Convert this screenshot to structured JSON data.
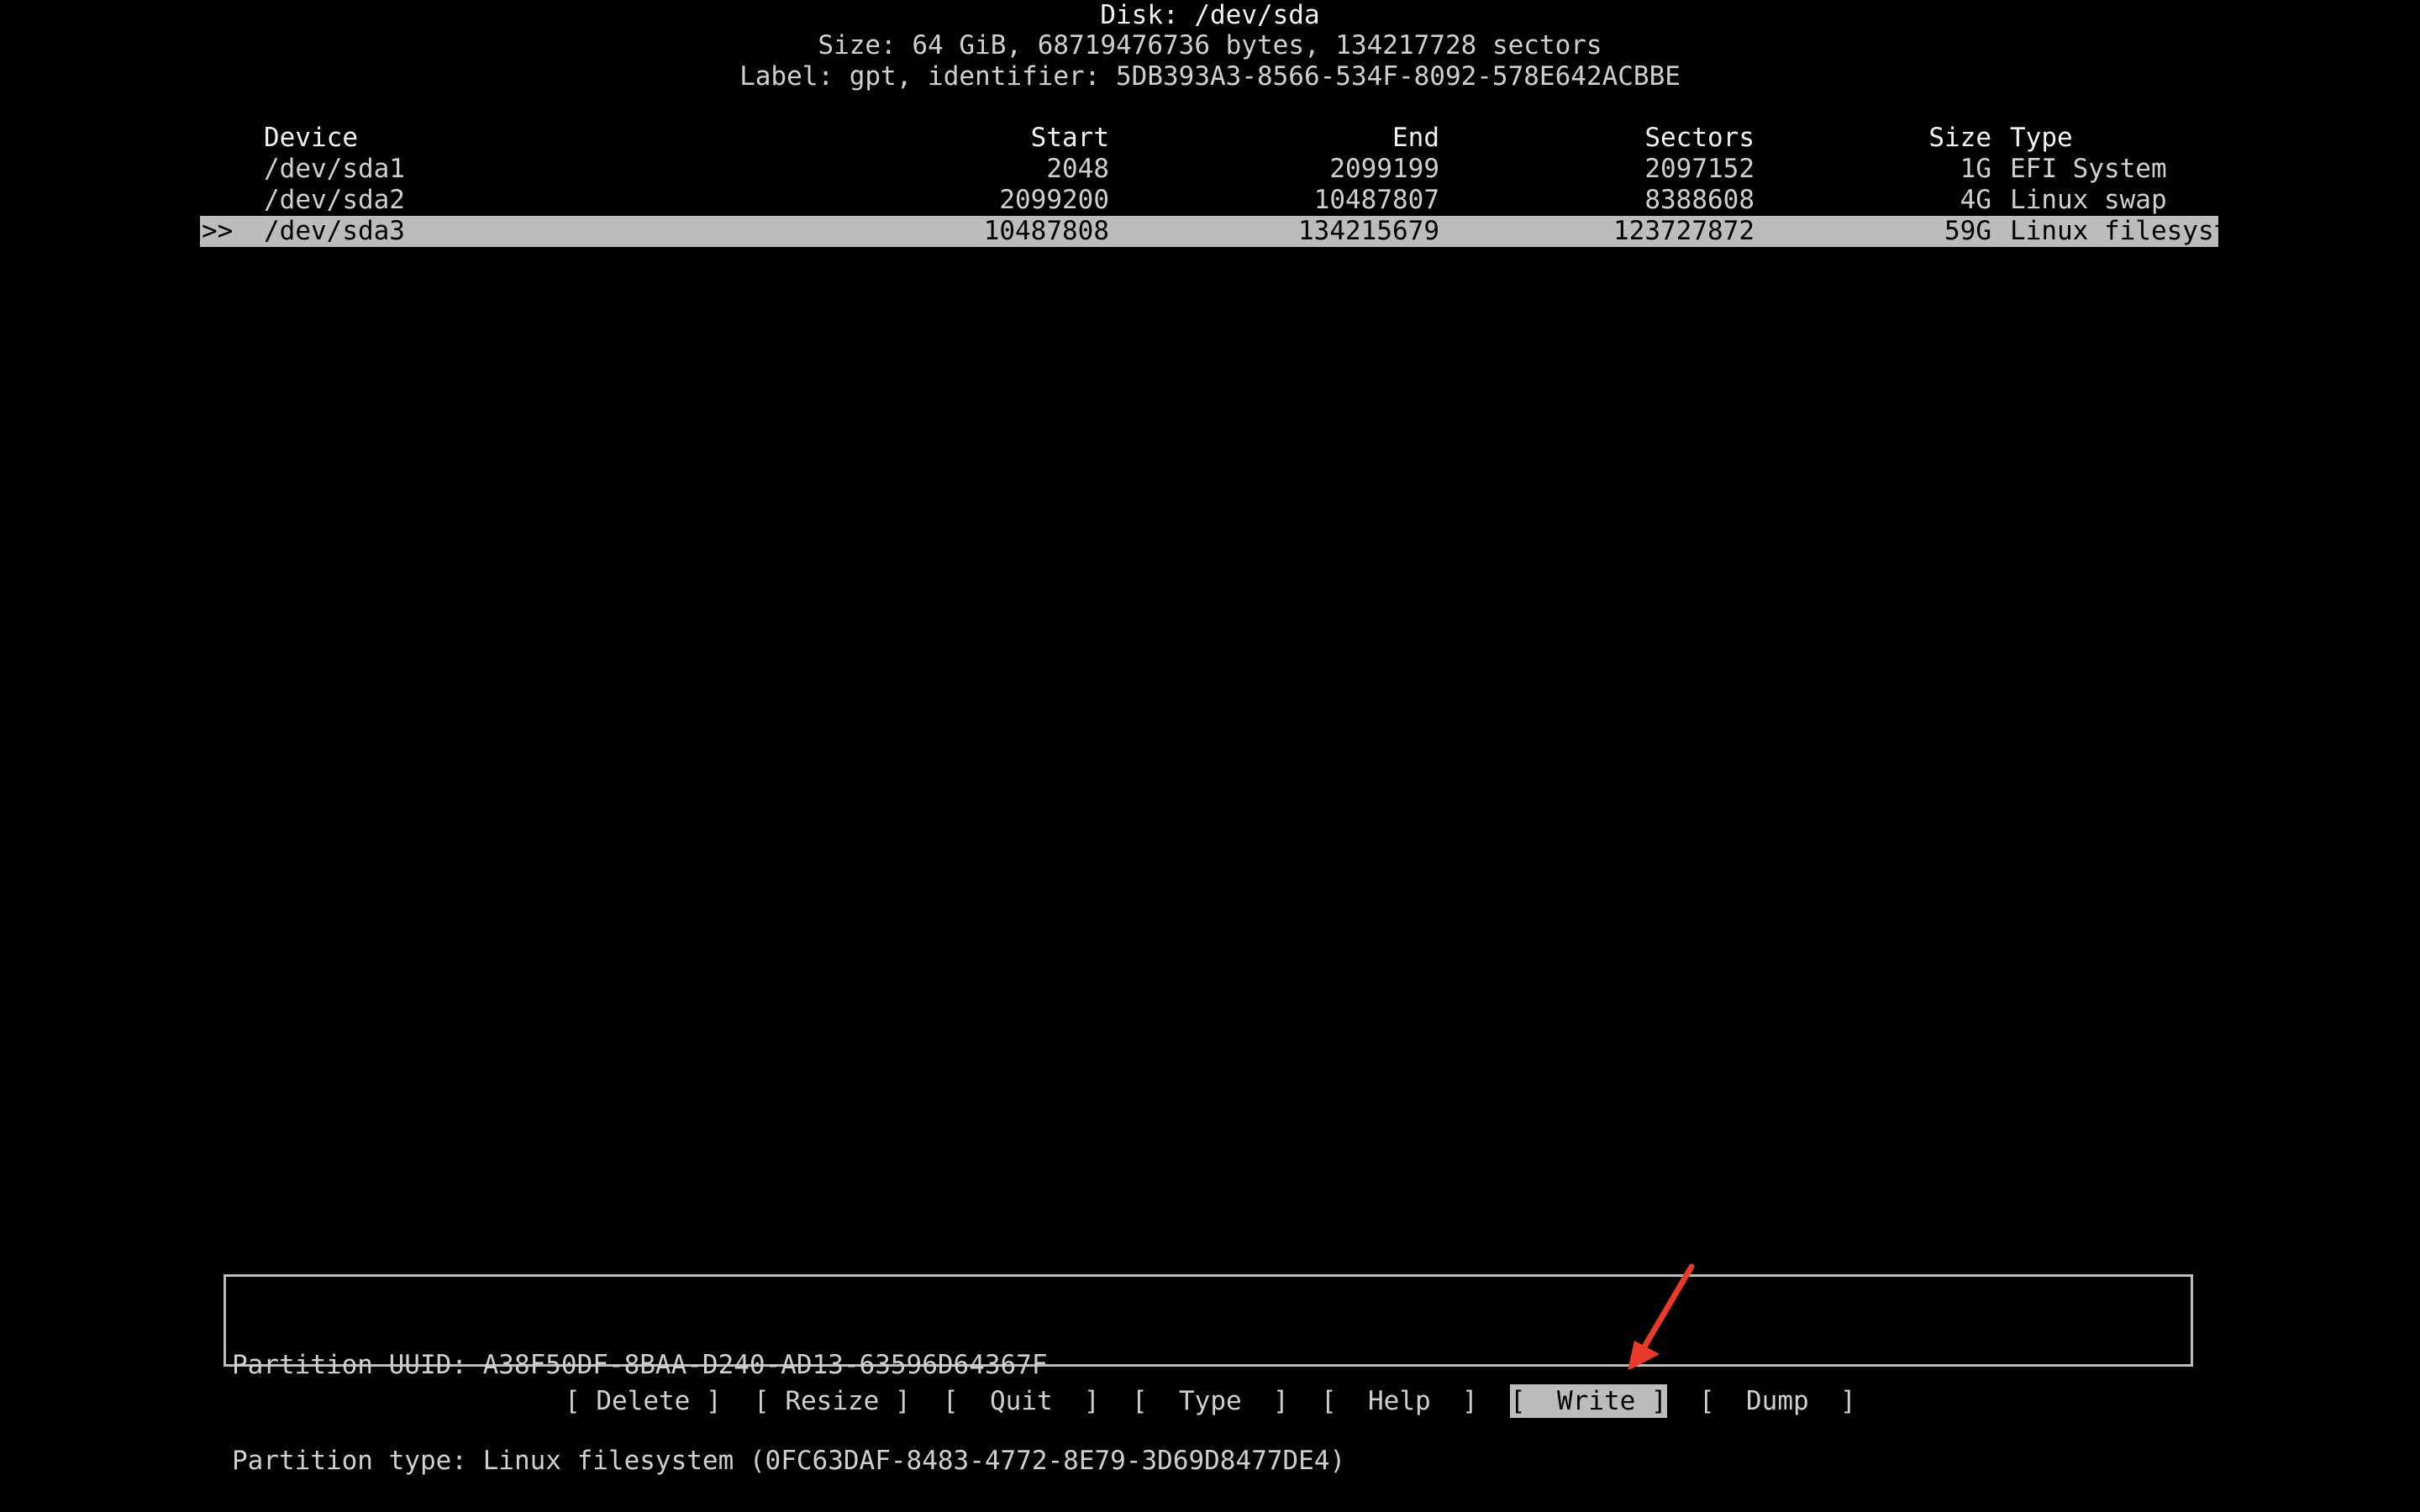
{
  "disk": {
    "title": "Disk: /dev/sda",
    "size": "Size: 64 GiB, 68719476736 bytes, 134217728 sectors",
    "label": "Label: gpt, identifier: 5DB393A3-8566-534F-8092-578E642ACBBE"
  },
  "table": {
    "headers": {
      "device": "Device",
      "start": "Start",
      "end": "End",
      "sectors": "Sectors",
      "size": "Size",
      "type": "Type"
    },
    "rows": [
      {
        "marker": "",
        "device": "/dev/sda1",
        "start": "2048",
        "end": "2099199",
        "sectors": "2097152",
        "size": "1G",
        "type": "EFI System"
      },
      {
        "marker": "",
        "device": "/dev/sda2",
        "start": "2099200",
        "end": "10487807",
        "sectors": "8388608",
        "size": "4G",
        "type": "Linux swap"
      },
      {
        "marker": ">>",
        "device": "/dev/sda3",
        "start": "10487808",
        "end": "134215679",
        "sectors": "123727872",
        "size": "59G",
        "type": "Linux filesystem"
      }
    ]
  },
  "info": {
    "uuid": "Partition UUID: A38F50DF-8BAA-D240-AD13-63596D64367F",
    "type": "Partition type: Linux filesystem (0FC63DAF-8483-4772-8E79-3D69D8477DE4)"
  },
  "menu": {
    "delete": "[ Delete ]",
    "resize": "[ Resize ]",
    "quit": "[  Quit  ]",
    "type": "[  Type  ]",
    "help": "[  Help  ]",
    "write": "[  Write ]",
    "dump": "[  Dump  ]"
  },
  "colors": {
    "background": "#000000",
    "text": "#cfcfcf",
    "highlight": "#bcbcbc",
    "arrow": "#e8392b"
  }
}
